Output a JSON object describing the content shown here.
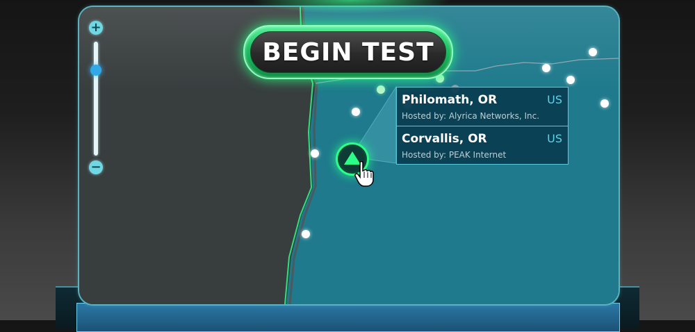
{
  "begin_button": {
    "label": "BEGIN TEST"
  },
  "zoom": {
    "plus_label": "+",
    "minus_label": "−",
    "level": 0.75
  },
  "popup": {
    "servers": [
      {
        "city": "Philomath, OR",
        "country": "US",
        "host": "Hosted by: Alyrica Networks, Inc."
      },
      {
        "city": "Corvallis, OR",
        "country": "US",
        "host": "Hosted by: PEAK Internet"
      }
    ]
  },
  "icons": {
    "zoom_in": "plus-icon",
    "zoom_out": "minus-icon",
    "selected_server": "triangle-up-icon",
    "cursor": "hand-pointer-icon"
  },
  "colors": {
    "accent_green": "#2cff87",
    "panel_teal": "#1b7486",
    "popup_border": "#5bc9dc",
    "country_text": "#5fd3ea"
  }
}
